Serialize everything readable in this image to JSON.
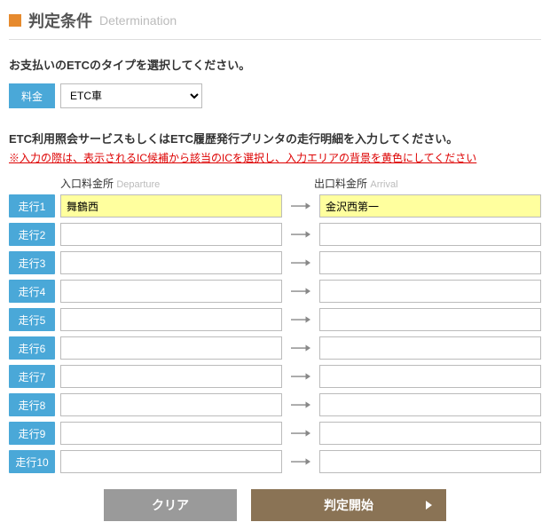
{
  "header": {
    "title": "判定条件",
    "subtitle": "Determination"
  },
  "instruction1": "お支払いのETCのタイプを選択してください。",
  "fee": {
    "label": "料金",
    "selected": "ETC車"
  },
  "instruction2": "ETC利用照会サービスもしくはETC履歴発行プリンタの走行明細を入力してください。",
  "note": "※入力の際は、表示されるIC候補から該当のICを選択し、入力エリアの背景を黄色にしてください",
  "columns": {
    "departure_jp": "入口料金所",
    "departure_en": "Departure",
    "arrival_jp": "出口料金所",
    "arrival_en": "Arrival"
  },
  "rows": [
    {
      "label": "走行1",
      "departure": "舞鶴西",
      "arrival": "金沢西第一",
      "active": true
    },
    {
      "label": "走行2",
      "departure": "",
      "arrival": "",
      "active": false
    },
    {
      "label": "走行3",
      "departure": "",
      "arrival": "",
      "active": false
    },
    {
      "label": "走行4",
      "departure": "",
      "arrival": "",
      "active": false
    },
    {
      "label": "走行5",
      "departure": "",
      "arrival": "",
      "active": false
    },
    {
      "label": "走行6",
      "departure": "",
      "arrival": "",
      "active": false
    },
    {
      "label": "走行7",
      "departure": "",
      "arrival": "",
      "active": false
    },
    {
      "label": "走行8",
      "departure": "",
      "arrival": "",
      "active": false
    },
    {
      "label": "走行9",
      "departure": "",
      "arrival": "",
      "active": false
    },
    {
      "label": "走行10",
      "departure": "",
      "arrival": "",
      "active": false
    }
  ],
  "buttons": {
    "clear": "クリア",
    "submit": "判定開始"
  }
}
